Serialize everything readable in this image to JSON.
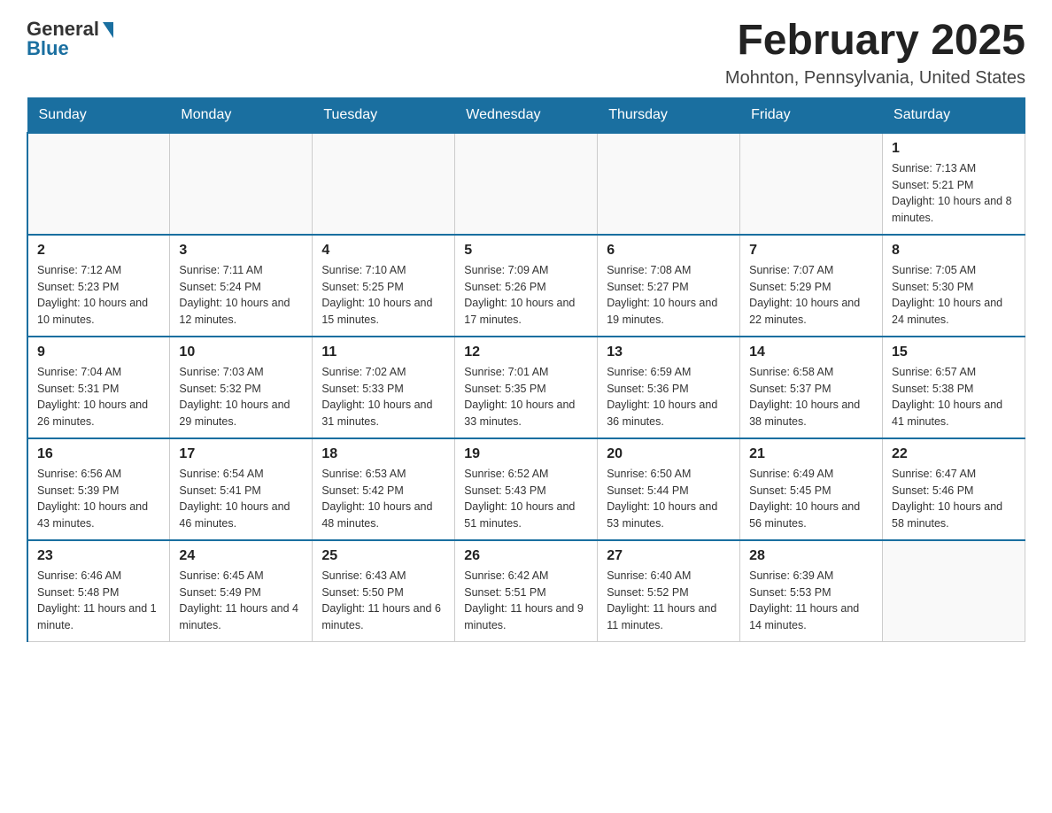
{
  "header": {
    "logo_general": "General",
    "logo_blue": "Blue",
    "title": "February 2025",
    "subtitle": "Mohnton, Pennsylvania, United States"
  },
  "calendar": {
    "weekdays": [
      "Sunday",
      "Monday",
      "Tuesday",
      "Wednesday",
      "Thursday",
      "Friday",
      "Saturday"
    ],
    "weeks": [
      [
        {
          "day": "",
          "info": ""
        },
        {
          "day": "",
          "info": ""
        },
        {
          "day": "",
          "info": ""
        },
        {
          "day": "",
          "info": ""
        },
        {
          "day": "",
          "info": ""
        },
        {
          "day": "",
          "info": ""
        },
        {
          "day": "1",
          "info": "Sunrise: 7:13 AM\nSunset: 5:21 PM\nDaylight: 10 hours and 8 minutes."
        }
      ],
      [
        {
          "day": "2",
          "info": "Sunrise: 7:12 AM\nSunset: 5:23 PM\nDaylight: 10 hours and 10 minutes."
        },
        {
          "day": "3",
          "info": "Sunrise: 7:11 AM\nSunset: 5:24 PM\nDaylight: 10 hours and 12 minutes."
        },
        {
          "day": "4",
          "info": "Sunrise: 7:10 AM\nSunset: 5:25 PM\nDaylight: 10 hours and 15 minutes."
        },
        {
          "day": "5",
          "info": "Sunrise: 7:09 AM\nSunset: 5:26 PM\nDaylight: 10 hours and 17 minutes."
        },
        {
          "day": "6",
          "info": "Sunrise: 7:08 AM\nSunset: 5:27 PM\nDaylight: 10 hours and 19 minutes."
        },
        {
          "day": "7",
          "info": "Sunrise: 7:07 AM\nSunset: 5:29 PM\nDaylight: 10 hours and 22 minutes."
        },
        {
          "day": "8",
          "info": "Sunrise: 7:05 AM\nSunset: 5:30 PM\nDaylight: 10 hours and 24 minutes."
        }
      ],
      [
        {
          "day": "9",
          "info": "Sunrise: 7:04 AM\nSunset: 5:31 PM\nDaylight: 10 hours and 26 minutes."
        },
        {
          "day": "10",
          "info": "Sunrise: 7:03 AM\nSunset: 5:32 PM\nDaylight: 10 hours and 29 minutes."
        },
        {
          "day": "11",
          "info": "Sunrise: 7:02 AM\nSunset: 5:33 PM\nDaylight: 10 hours and 31 minutes."
        },
        {
          "day": "12",
          "info": "Sunrise: 7:01 AM\nSunset: 5:35 PM\nDaylight: 10 hours and 33 minutes."
        },
        {
          "day": "13",
          "info": "Sunrise: 6:59 AM\nSunset: 5:36 PM\nDaylight: 10 hours and 36 minutes."
        },
        {
          "day": "14",
          "info": "Sunrise: 6:58 AM\nSunset: 5:37 PM\nDaylight: 10 hours and 38 minutes."
        },
        {
          "day": "15",
          "info": "Sunrise: 6:57 AM\nSunset: 5:38 PM\nDaylight: 10 hours and 41 minutes."
        }
      ],
      [
        {
          "day": "16",
          "info": "Sunrise: 6:56 AM\nSunset: 5:39 PM\nDaylight: 10 hours and 43 minutes."
        },
        {
          "day": "17",
          "info": "Sunrise: 6:54 AM\nSunset: 5:41 PM\nDaylight: 10 hours and 46 minutes."
        },
        {
          "day": "18",
          "info": "Sunrise: 6:53 AM\nSunset: 5:42 PM\nDaylight: 10 hours and 48 minutes."
        },
        {
          "day": "19",
          "info": "Sunrise: 6:52 AM\nSunset: 5:43 PM\nDaylight: 10 hours and 51 minutes."
        },
        {
          "day": "20",
          "info": "Sunrise: 6:50 AM\nSunset: 5:44 PM\nDaylight: 10 hours and 53 minutes."
        },
        {
          "day": "21",
          "info": "Sunrise: 6:49 AM\nSunset: 5:45 PM\nDaylight: 10 hours and 56 minutes."
        },
        {
          "day": "22",
          "info": "Sunrise: 6:47 AM\nSunset: 5:46 PM\nDaylight: 10 hours and 58 minutes."
        }
      ],
      [
        {
          "day": "23",
          "info": "Sunrise: 6:46 AM\nSunset: 5:48 PM\nDaylight: 11 hours and 1 minute."
        },
        {
          "day": "24",
          "info": "Sunrise: 6:45 AM\nSunset: 5:49 PM\nDaylight: 11 hours and 4 minutes."
        },
        {
          "day": "25",
          "info": "Sunrise: 6:43 AM\nSunset: 5:50 PM\nDaylight: 11 hours and 6 minutes."
        },
        {
          "day": "26",
          "info": "Sunrise: 6:42 AM\nSunset: 5:51 PM\nDaylight: 11 hours and 9 minutes."
        },
        {
          "day": "27",
          "info": "Sunrise: 6:40 AM\nSunset: 5:52 PM\nDaylight: 11 hours and 11 minutes."
        },
        {
          "day": "28",
          "info": "Sunrise: 6:39 AM\nSunset: 5:53 PM\nDaylight: 11 hours and 14 minutes."
        },
        {
          "day": "",
          "info": ""
        }
      ]
    ]
  }
}
